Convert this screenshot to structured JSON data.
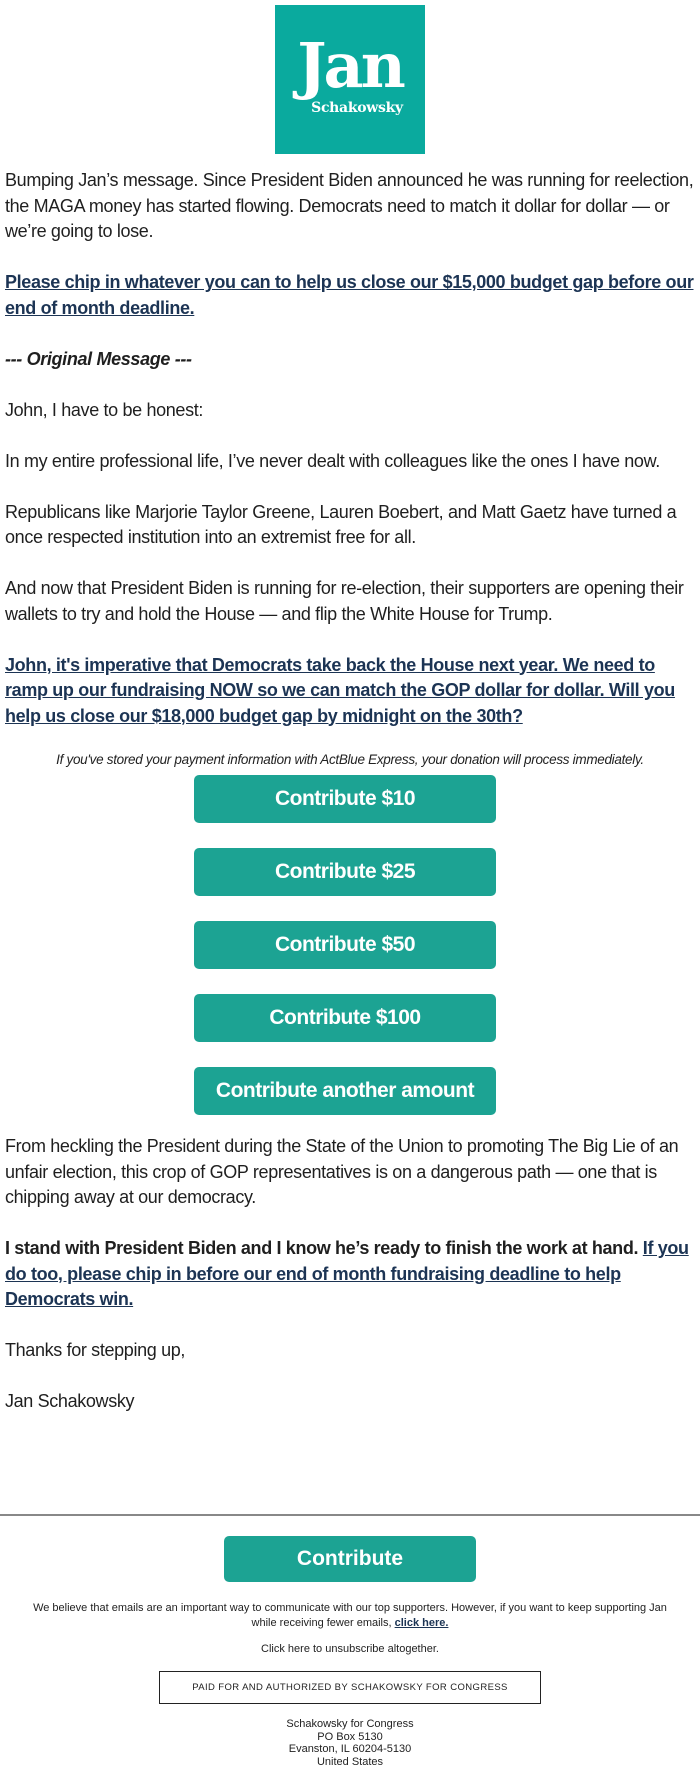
{
  "logo": {
    "name": "Jan",
    "surname": "Schakowsky",
    "color": "#0aaa9e"
  },
  "body": {
    "intro": "Bumping Jan’s message. Since President Biden announced he was running for reelection, the MAGA money has started flowing. Democrats need to match it dollar for dollar — or we’re going to lose.",
    "cta_link_1": "Please chip in whatever you can to help us close our $15,000 budget gap before our end of month deadline.",
    "original_message_label": "--- Original Message ---",
    "greeting": "John, I have to be honest:",
    "para_1": "In my entire professional life, I’ve never dealt with colleagues like the ones I have now.",
    "para_2": "Republicans like Marjorie Taylor Greene, Lauren Boebert, and Matt Gaetz have turned a once respected institution into an extremist free for all.",
    "para_3": "And now that President Biden is running for re-election, their supporters are opening their wallets to try and hold the House — and flip the White House for Trump.",
    "cta_link_2": "John, it's imperative that Democrats take back the House next year. We need to ramp up our fundraising NOW so we can match the GOP dollar for dollar. Will you help us close our $18,000 budget gap by midnight on the 30th?",
    "actblue_note": "If you've stored your payment information with ActBlue Express, your donation will process immediately.",
    "donate_buttons": [
      {
        "label": "Contribute $10"
      },
      {
        "label": "Contribute $25"
      },
      {
        "label": "Contribute $50"
      },
      {
        "label": "Contribute $100"
      },
      {
        "label": "Contribute another amount"
      }
    ],
    "para_4": "From heckling the President during the State of the Union to promoting The Big Lie of an unfair election, this crop of GOP representatives is on a dangerous path — one that is chipping away at our democracy.",
    "closing_bold": "I stand with President Biden and I know he’s ready to finish the work at hand.",
    "cta_link_3": "If you do too, please chip in before our end of month fundraising deadline to help Democrats win.",
    "signoff": "Thanks for stepping up,",
    "signature": "Jan Schakowsky"
  },
  "footer": {
    "contribute_label": "Contribute",
    "fewer_emails_text": "We believe that emails are an important way to communicate with our top supporters. However, if you want to keep supporting Jan while receiving fewer emails,",
    "fewer_emails_link": "click here.",
    "unsubscribe": "Click here to unsubscribe altogether.",
    "paid_for": "PAID FOR AND AUTHORIZED BY SCHAKOWSKY FOR CONGRESS",
    "address": {
      "org": "Schakowsky for Congress",
      "line1": "PO Box 5130",
      "line2": "Evanston, IL 60204-5130",
      "country": "United States"
    }
  },
  "colors": {
    "button": "#1ca393",
    "link": "#1c3454",
    "logo": "#0aaa9e"
  }
}
